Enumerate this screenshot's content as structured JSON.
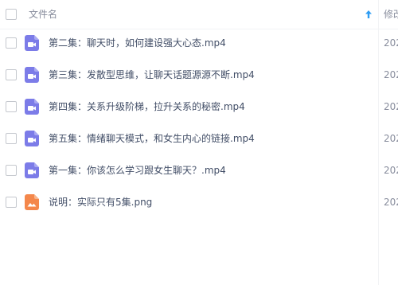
{
  "header": {
    "name_label": "文件名",
    "date_label": "修改"
  },
  "files": [
    {
      "name": "第二集：聊天时，如何建设强大心态.mp4",
      "type": "video",
      "date": "202"
    },
    {
      "name": "第三集：发散型思维，让聊天话题源源不断.mp4",
      "type": "video",
      "date": "202"
    },
    {
      "name": "第四集：关系升级阶梯，拉升关系的秘密.mp4",
      "type": "video",
      "date": "202"
    },
    {
      "name": "第五集：情绪聊天模式，和女生内心的链接.mp4",
      "type": "video",
      "date": "202"
    },
    {
      "name": "第一集：你该怎么学习跟女生聊天？.mp4",
      "type": "video",
      "date": "202"
    },
    {
      "name": "说明：实际只有5集.png",
      "type": "image",
      "date": "202"
    }
  ],
  "colors": {
    "video_icon": "#7c7ce8",
    "image_icon": "#f4874b",
    "accent": "#2e9cf3"
  },
  "icons": {
    "video": "video-file-icon",
    "image": "image-file-icon",
    "sort": "sort-ascending-icon"
  }
}
